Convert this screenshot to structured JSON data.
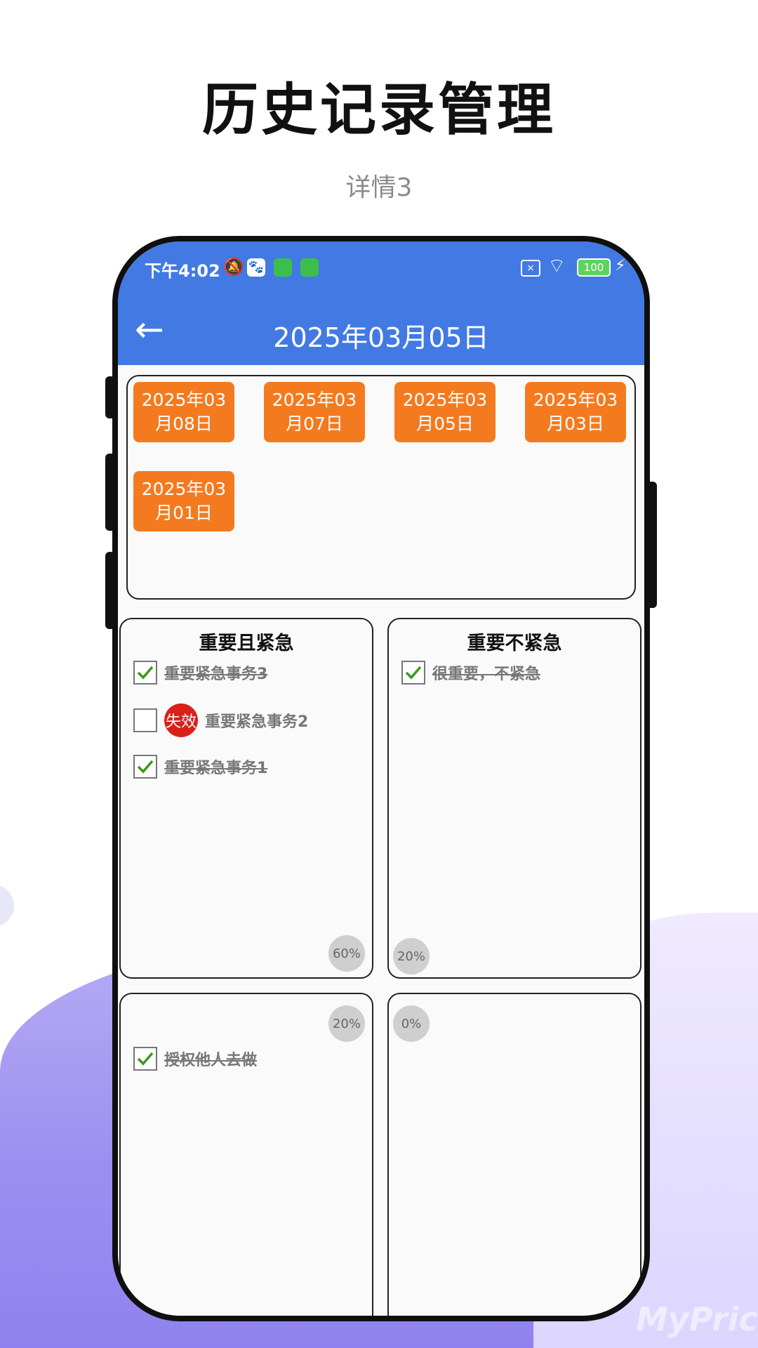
{
  "headline": "历史记录管理",
  "subtitle": "详情3",
  "status": {
    "time": "下午4:02",
    "battery": "100"
  },
  "appbar": {
    "title": "2025年03月05日"
  },
  "dates": [
    {
      "l1": "2025年03",
      "l2": "月08日"
    },
    {
      "l1": "2025年03",
      "l2": "月07日"
    },
    {
      "l1": "2025年03",
      "l2": "月05日"
    },
    {
      "l1": "2025年03",
      "l2": "月03日"
    },
    {
      "l1": "2025年03",
      "l2": "月01日"
    }
  ],
  "quadrants": {
    "q1": {
      "title": "重要且紧急",
      "percent": "60%",
      "tasks": [
        {
          "text": "重要紧急事务3",
          "done": true
        },
        {
          "text": "重要紧急事务2",
          "done": false,
          "badge": "失效"
        },
        {
          "text": "重要紧急事务1",
          "done": true
        }
      ]
    },
    "q2": {
      "title": "重要不紧急",
      "percent": "20%",
      "tasks": [
        {
          "text": "很重要，不紧急",
          "done": true
        }
      ]
    },
    "q3": {
      "title": "",
      "percent": "20%",
      "tasks": [
        {
          "text": "授权他人去做",
          "done": true
        }
      ]
    },
    "q4": {
      "title": "",
      "percent": "0%",
      "tasks": []
    }
  },
  "watermark": "MyPrice",
  "colors": {
    "primary": "#4279e3",
    "chip": "#f47a20",
    "badge": "#d9211a",
    "check": "#3a9a1a"
  }
}
